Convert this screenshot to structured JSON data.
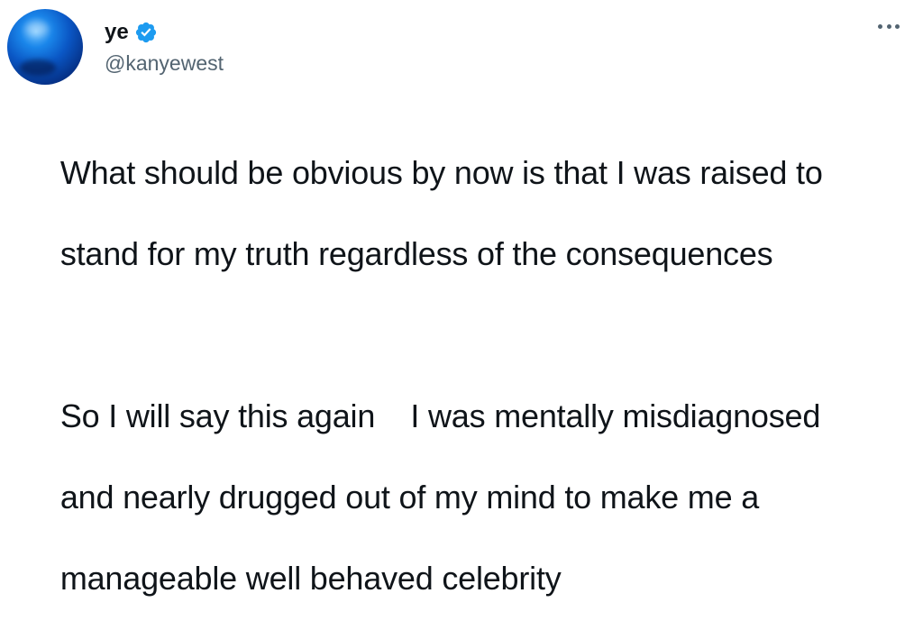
{
  "tweet": {
    "author": {
      "display_name": "ye",
      "handle": "@kanyewest",
      "verified": true,
      "verified_color": "#1d9bf0",
      "avatar_color": "#0a56c4"
    },
    "more_icon": "more-horizontal-icon",
    "paragraphs": [
      {
        "lines": [
          "What should be obvious by now is that I was raised to",
          "stand for my truth regardless of the consequences"
        ]
      },
      {
        "lines": [
          "So I will say this again    I was mentally misdiagnosed",
          "and nearly drugged out of my mind to make me a",
          "manageable well behaved celebrity"
        ]
      }
    ]
  }
}
